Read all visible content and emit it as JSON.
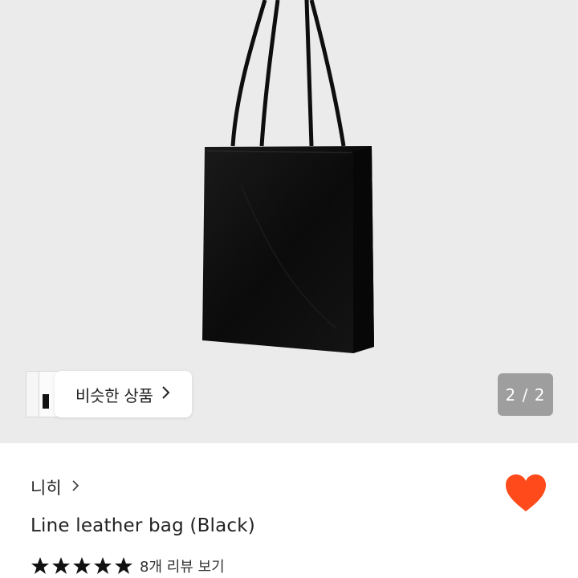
{
  "colors": {
    "gallery_background": "#ebebeb",
    "heart": "#ff4a1c",
    "page_indicator_background": "#9e9e9e",
    "star": "#111111"
  },
  "gallery": {
    "page_indicator": "2 / 2",
    "similar_products": {
      "label": "비슷한 상품",
      "icon": "chevron-right-icon"
    }
  },
  "product": {
    "shop_name": "니히",
    "title": "Line leather bag (Black)",
    "rating": 5,
    "rating_max": 5,
    "review_link": "8개 리뷰 보기",
    "favorite_icon": "heart-icon"
  }
}
